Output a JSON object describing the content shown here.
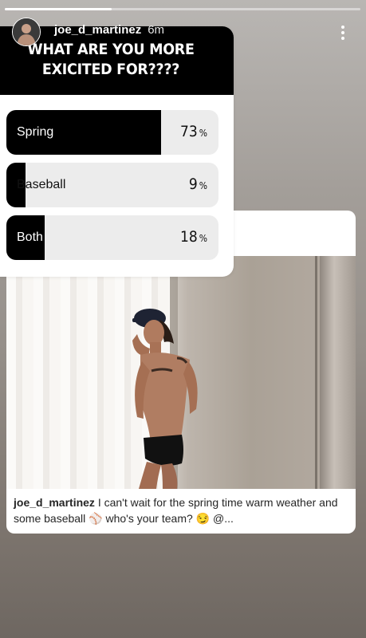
{
  "story": {
    "username": "joe_d_martinez",
    "time": "6m",
    "progress": 0.3
  },
  "poll": {
    "question": "WHAT ARE YOU MORE EXICITED FOR????",
    "options": [
      {
        "label": "Spring",
        "percent": "73",
        "value": 73
      },
      {
        "label": "Baseball",
        "percent": "9",
        "value": 9
      },
      {
        "label": "Both",
        "percent": "18",
        "value": 18
      }
    ],
    "percent_sign": "%"
  },
  "post": {
    "username": "joe_d_martinez",
    "caption": "I can't wait for the spring time warm weather and some baseball ⚾ who's your team? 😏 @..."
  },
  "icons": {
    "more": "more-vertical-icon"
  }
}
